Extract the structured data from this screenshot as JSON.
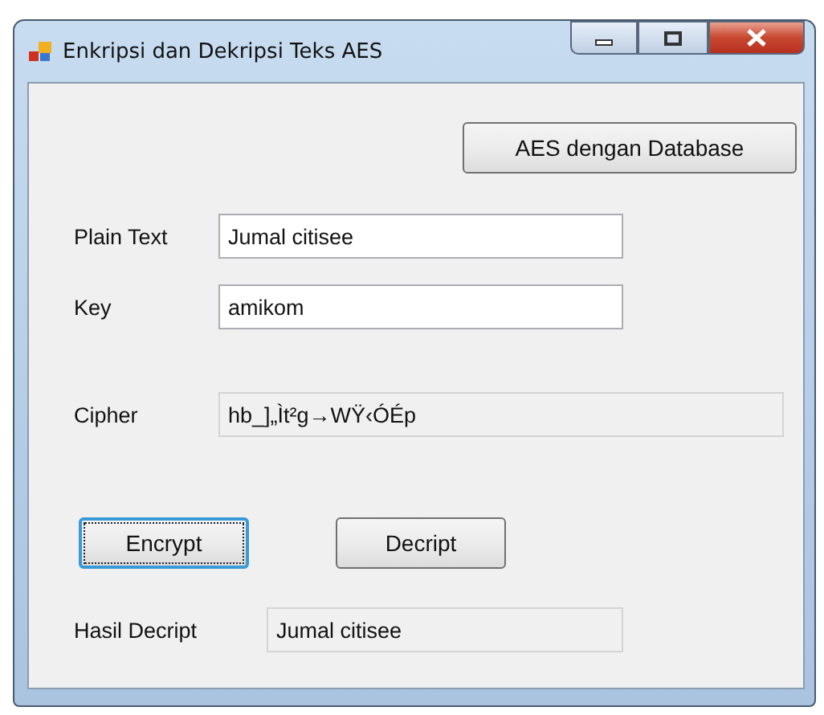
{
  "window": {
    "title": "Enkripsi dan Dekripsi Teks AES"
  },
  "database_button": {
    "label": "AES dengan Database",
    "focused": false
  },
  "fields": [
    {
      "label": "Plain Text",
      "value": "Jumal citisee",
      "readonly": false
    },
    {
      "label": "Key",
      "value": "amikom",
      "readonly": false
    },
    {
      "label": "Cipher",
      "value": "hb_]„Ìt²g→WŸ‹ÓÉp",
      "readonly": true
    }
  ],
  "buttons": [
    {
      "label": "Encrypt",
      "focused": true
    },
    {
      "label": "Decript",
      "focused": false
    }
  ],
  "result": {
    "label": "Hasil Decript",
    "value": "Jumal citisee",
    "readonly": true
  }
}
